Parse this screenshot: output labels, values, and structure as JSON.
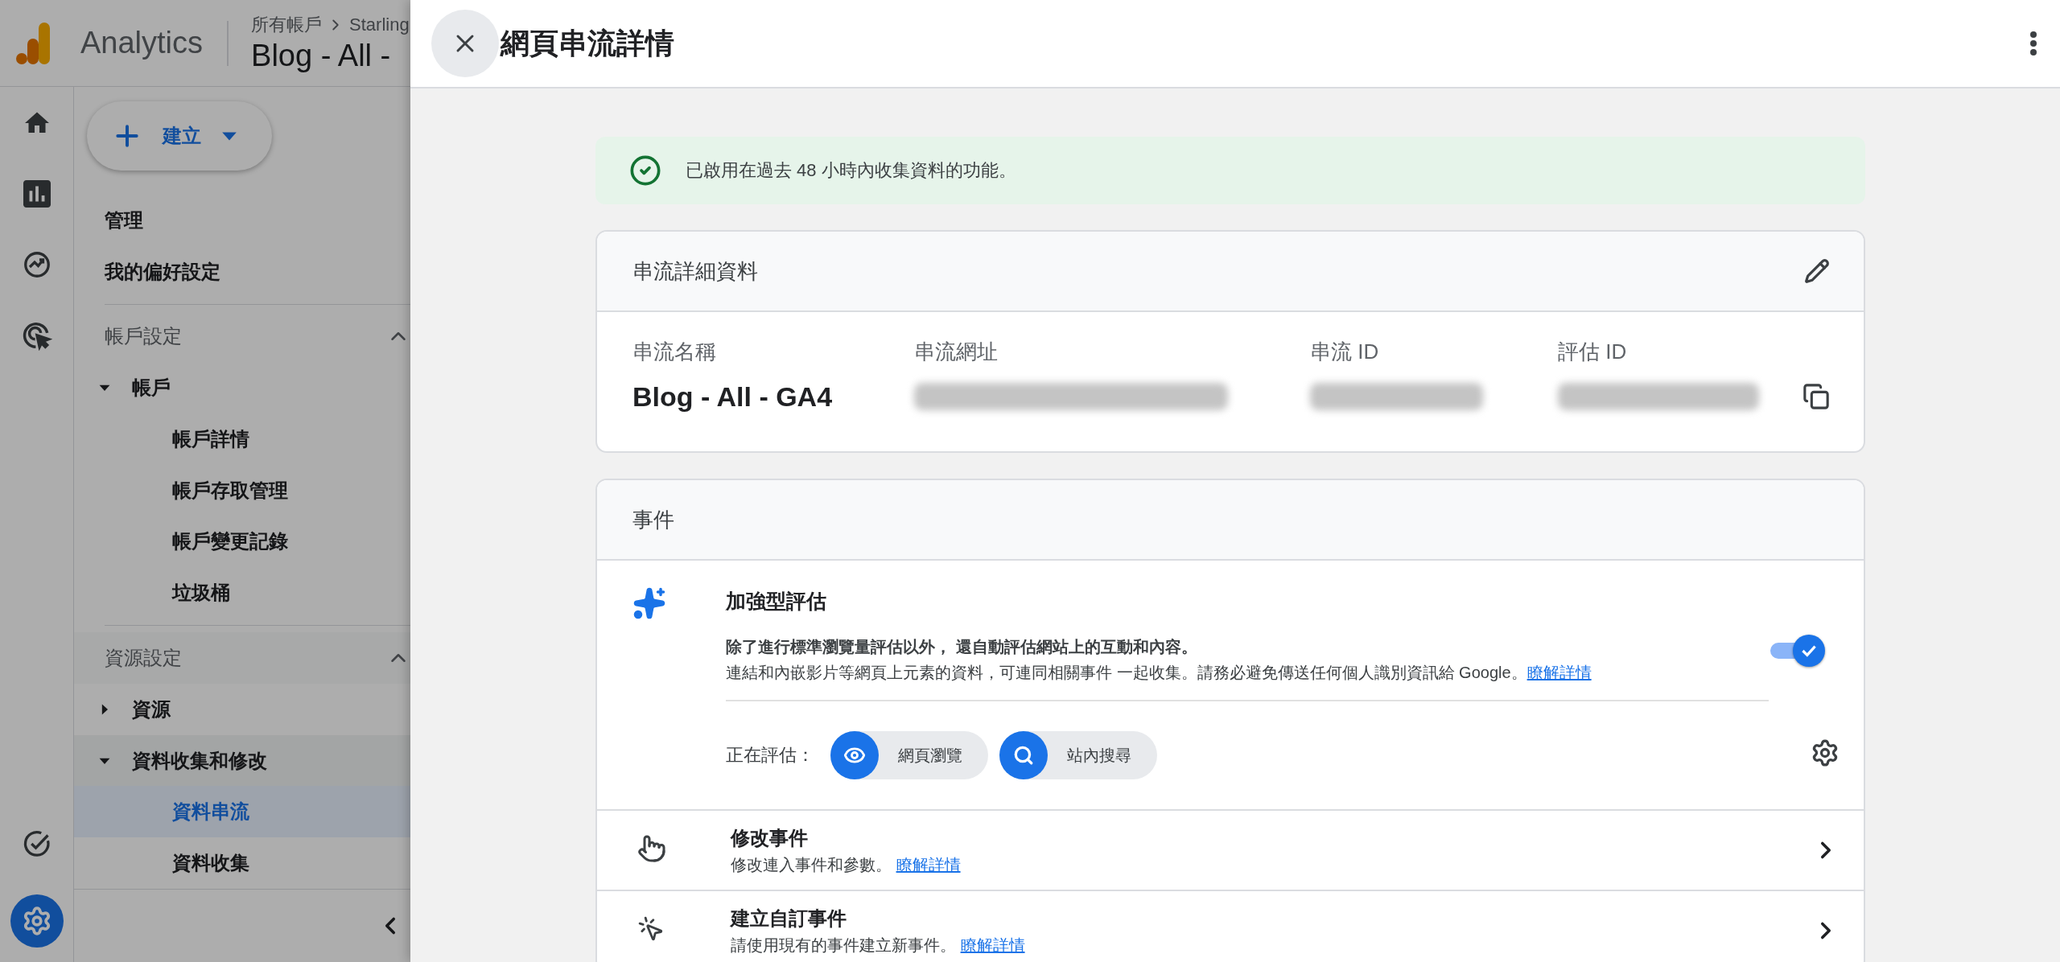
{
  "app": {
    "name": "Analytics",
    "breadcrumb": [
      "所有帳戶",
      "Starling"
    ],
    "property": "Blog - All -"
  },
  "rail": {
    "top": [
      {
        "kind": "home",
        "selected": false
      },
      {
        "kind": "reports",
        "selected": false
      },
      {
        "kind": "explore",
        "selected": false
      },
      {
        "kind": "advertising",
        "selected": false
      }
    ],
    "bottom": [
      {
        "kind": "insights",
        "selected": false
      },
      {
        "kind": "admin",
        "selected": true
      }
    ]
  },
  "create_button": {
    "label": "建立"
  },
  "nav": {
    "top_items": [
      {
        "label": "管理"
      },
      {
        "label": "我的偏好設定"
      }
    ],
    "sections": [
      {
        "title": "帳戶設定",
        "expanded": true,
        "items": [
          {
            "label": "帳戶",
            "expanded": true,
            "children": [
              {
                "label": "帳戶詳情",
                "selected": false
              },
              {
                "label": "帳戶存取管理",
                "selected": false
              },
              {
                "label": "帳戶變更記錄",
                "selected": false
              },
              {
                "label": "垃圾桶",
                "selected": false
              }
            ]
          }
        ]
      },
      {
        "title": "資源設定",
        "expanded": true,
        "items": [
          {
            "label": "資源",
            "expanded": false
          },
          {
            "label": "資料收集和修改",
            "expanded": true,
            "children": [
              {
                "label": "資料串流",
                "selected": true
              },
              {
                "label": "資料收集",
                "selected": false
              }
            ]
          }
        ]
      }
    ]
  },
  "panel": {
    "title": "網頁串流詳情",
    "banner": {
      "text": "已啟用在過去 48 小時內收集資料的功能。"
    },
    "details": {
      "title": "串流詳細資料",
      "fields": [
        {
          "label": "串流名稱",
          "value": "Blog - All - GA4",
          "redacted": false
        },
        {
          "label": "串流網址",
          "redacted": true
        },
        {
          "label": "串流 ID",
          "redacted": true
        },
        {
          "label": "評估 ID",
          "redacted": true
        }
      ]
    },
    "events": {
      "title": "事件",
      "enhanced": {
        "title": "加強型評估",
        "description": "除了進行標準瀏覽量評估以外， 還自動評估網站上的互動和內容。",
        "note": "連結和內嵌影片等網頁上元素的資料，可連同相關事件 一起收集。請務必避免傳送任何個人識別資訊給 Google。",
        "link": "瞭解詳情",
        "on": true,
        "measuring_label": "正在評估：",
        "measuring": [
          {
            "kind": "page_views",
            "label": "網頁瀏覽"
          },
          {
            "kind": "site_search",
            "label": "站內搜尋"
          }
        ]
      },
      "rows": [
        {
          "kind": "modify",
          "title": "修改事件",
          "subtitle": "修改連入事件和參數。",
          "link": "瞭解詳情"
        },
        {
          "kind": "create",
          "title": "建立自訂事件",
          "subtitle": "請使用現有的事件建立新事件。",
          "link": "瞭解詳情"
        }
      ]
    }
  }
}
